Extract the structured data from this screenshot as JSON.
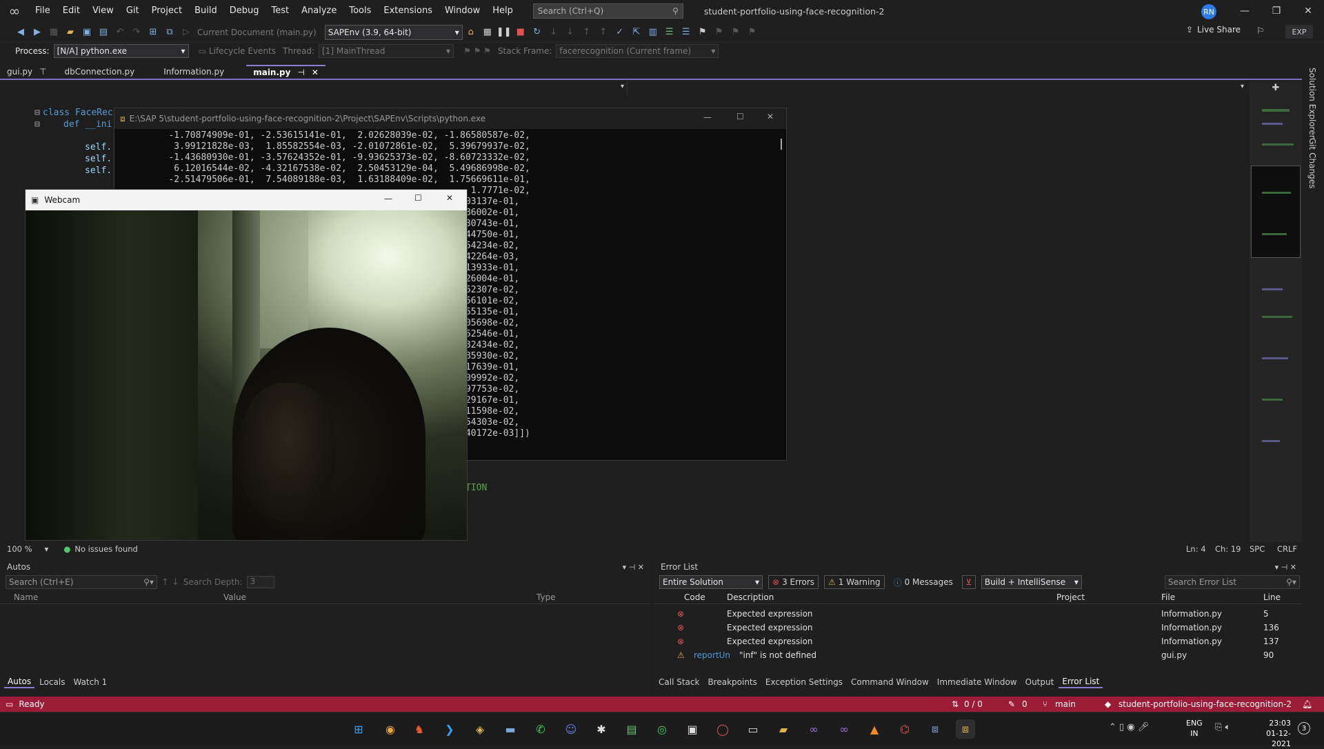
{
  "menu": [
    "File",
    "Edit",
    "View",
    "Git",
    "Project",
    "Build",
    "Debug",
    "Test",
    "Analyze",
    "Tools",
    "Extensions",
    "Window",
    "Help"
  ],
  "search_placeholder": "Search (Ctrl+Q)",
  "solution_title": "student-portfolio-using-face-recognition-2",
  "avatar": "RN",
  "live_share": "Live Share",
  "exp": "EXP",
  "toolbar": {
    "current_doc": "Current Document (main.py)",
    "env": "SAPEnv (3.9, 64-bit)"
  },
  "debugbar": {
    "process_label": "Process:",
    "process_value": "[N/A] python.exe",
    "lifecycle": "Lifecycle Events",
    "thread_label": "Thread:",
    "thread_value": "[1] MainThread",
    "stack_label": "Stack Frame:",
    "stack_value": "facerecognition (Current frame)"
  },
  "tabs": [
    "gui.py",
    "dbConnection.py",
    "Information.py",
    "main.py"
  ],
  "code": {
    "line1": "class FaceRec",
    "line2": "def __ini",
    "self1": "self.",
    "self2": "self.",
    "self3": "self.",
    "tion": "TION"
  },
  "console": {
    "title": "E:\\SAP 5\\student-portfolio-using-face-recognition-2\\Project\\SAPEnv\\Scripts\\python.exe",
    "lines": [
      "   -1.70874909e-01, -2.53615141e-01,  2.02628039e-02, -1.86580587e-02,",
      "    3.99121828e-03,  1.85582554e-03, -2.01072861e-02,  5.39679937e-02,",
      "   -1.43680930e-01, -3.57624352e-01, -9.93625373e-02, -8.60723332e-02,",
      "    6.12016544e-02, -4.32167538e-02,  2.50453129e-04,  5.49686998e-02,",
      "   -2.51479506e-01,  7.54089188e-03,  1.63188409e-02,  1.75669611e-01,",
      "                                                           1.7771e-02,",
      "                                                          03137e-01,",
      "                                                          86002e-01,",
      "                                                          30743e-01,",
      "                                                          44750e-01,",
      "                                                          54234e-02,",
      "                                                          42264e-03,",
      "                                                          13933e-01,",
      "                                                          26004e-01,",
      "                                                          52307e-02,",
      "                                                          56101e-02,",
      "                                                          55135e-01,",
      "                                                          05698e-02,",
      "                                                          52546e-01,",
      "                                                          32434e-02,",
      "                                                          85930e-02,",
      "                                                          17639e-01,",
      "                                                          09992e-02,",
      "                                                          97753e-02,",
      "                                                          29167e-01,",
      "                                                          11598e-02,",
      "                                                          54303e-02,",
      "                                                          40172e-03]])"
    ]
  },
  "webcam_title": "Webcam",
  "status": {
    "zoom": "100 %",
    "issues": "No issues found",
    "ln": "Ln: 4",
    "ch": "Ch: 19",
    "spc": "SPC",
    "crlf": "CRLF"
  },
  "autos": {
    "title": "Autos",
    "search": "Search (Ctrl+E)",
    "depth_label": "Search Depth:",
    "depth_value": "3",
    "cols": [
      "Name",
      "Value",
      "Type"
    ],
    "tabs": [
      "Autos",
      "Locals",
      "Watch 1"
    ]
  },
  "errors": {
    "title": "Error List",
    "scope": "Entire Solution",
    "errors_btn": "3 Errors",
    "warning_btn": "1 Warning",
    "messages_btn": "0 Messages",
    "build": "Build + IntelliSense",
    "search": "Search Error List",
    "cols": [
      "Code",
      "Description",
      "Project",
      "File",
      "Line"
    ],
    "rows": [
      {
        "code": "",
        "desc": "Expected expression",
        "file": "Information.py",
        "line": "5"
      },
      {
        "code": "",
        "desc": "Expected expression",
        "file": "Information.py",
        "line": "136"
      },
      {
        "code": "",
        "desc": "Expected expression",
        "file": "Information.py",
        "line": "137"
      },
      {
        "code": "reportUn",
        "desc": "\"inf\" is not defined",
        "file": "gui.py",
        "line": "90"
      }
    ],
    "tabs": [
      "Call Stack",
      "Breakpoints",
      "Exception Settings",
      "Command Window",
      "Immediate Window",
      "Output",
      "Error List"
    ]
  },
  "statusbar": {
    "ready": "Ready",
    "updown": "0 / 0",
    "pencil": "0",
    "branch": "main",
    "repo": "student-portfolio-using-face-recognition-2"
  },
  "tray": {
    "lang1": "ENG",
    "lang2": "IN",
    "time": "23:03",
    "date": "01-12-2021",
    "notif": "3"
  },
  "side": {
    "solution_explorer": "Solution Explorer",
    "git_changes": "Git Changes"
  }
}
